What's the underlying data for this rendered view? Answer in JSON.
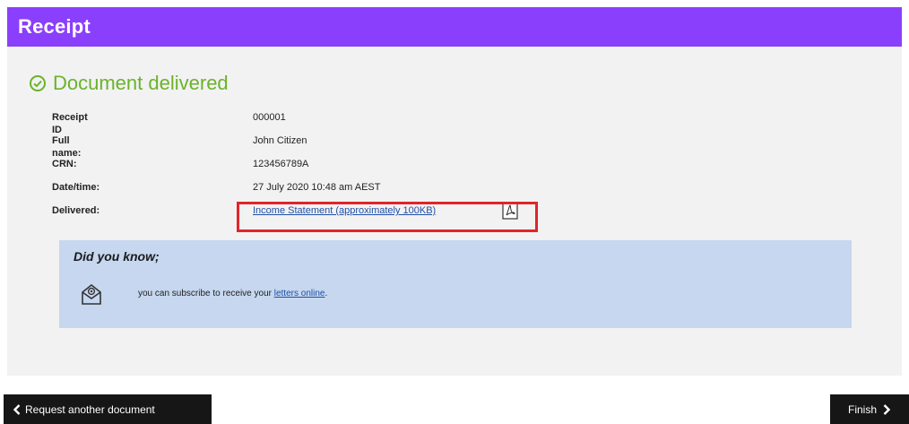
{
  "header": {
    "title": "Receipt"
  },
  "status": {
    "text": "Document delivered",
    "color": "#6bb32a"
  },
  "details": {
    "receipt_id_label": "Receipt ID",
    "receipt_id_value": "000001",
    "full_name_label": "Full name:",
    "full_name_value": "John Citizen",
    "crn_label": "CRN:",
    "crn_value": "123456789A",
    "datetime_label": "Date/time:",
    "datetime_value": "27 July 2020 10:48 am AEST",
    "delivered_label": "Delivered:",
    "delivered_link": "Income Statement (approximately 100KB)"
  },
  "info": {
    "title": "Did you know;",
    "text_before": "you can subscribe to receive your ",
    "link": "letters online",
    "text_after": "."
  },
  "buttons": {
    "back_label": "Request another document",
    "finish_label": "Finish"
  },
  "colors": {
    "header": "#8a3ffc",
    "highlight": "#e0252a",
    "info_bg": "#c6d7ef"
  },
  "icons": [
    "check-circle-icon",
    "pdf-icon",
    "mail-icon",
    "chevron-left-icon",
    "chevron-right-icon"
  ]
}
